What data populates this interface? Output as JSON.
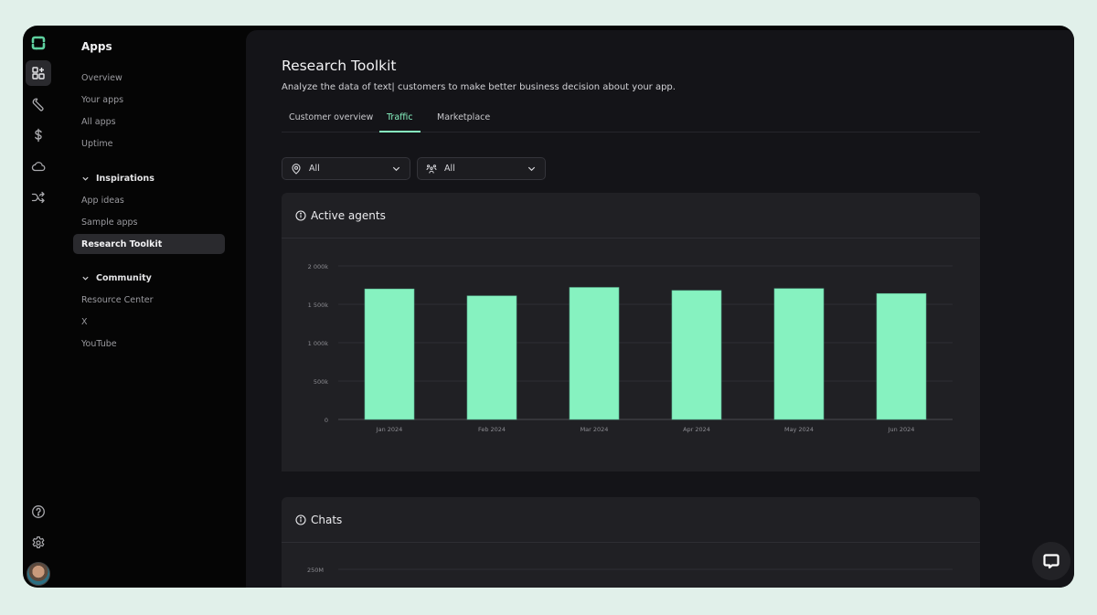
{
  "rail": {
    "items": [
      {
        "icon": "apps-grid-icon",
        "active": true
      },
      {
        "icon": "wrench-icon",
        "active": false
      },
      {
        "icon": "dollar-icon",
        "active": false
      },
      {
        "icon": "cloud-icon",
        "active": false
      },
      {
        "icon": "shuffle-icon",
        "active": false
      }
    ],
    "bottom": [
      {
        "icon": "help-icon"
      },
      {
        "icon": "gear-icon"
      }
    ]
  },
  "nav": {
    "title": "Apps",
    "items": [
      {
        "label": "Overview"
      },
      {
        "label": "Your apps"
      },
      {
        "label": "All apps"
      },
      {
        "label": "Uptime"
      }
    ],
    "sections": [
      {
        "label": "Inspirations",
        "items": [
          {
            "label": "App ideas"
          },
          {
            "label": "Sample apps"
          },
          {
            "label": "Research Toolkit",
            "active": true
          }
        ]
      },
      {
        "label": "Community",
        "items": [
          {
            "label": "Resource Center"
          },
          {
            "label": "X"
          },
          {
            "label": "YouTube"
          }
        ]
      }
    ]
  },
  "page": {
    "title": "Research Toolkit",
    "description": "Analyze the data of text| customers to make better business decision about your app.",
    "tabs": [
      {
        "label": "Customer overview",
        "active": false
      },
      {
        "label": "Traffic",
        "active": true
      },
      {
        "label": "Marketplace",
        "active": false
      }
    ],
    "filters": [
      {
        "icon": "location-pin-icon",
        "value": "All"
      },
      {
        "icon": "users-group-icon",
        "value": "All"
      }
    ]
  },
  "colors": {
    "accent": "#86f2c0",
    "bar": "#86f2c0",
    "background": "#141418",
    "card": "#202024"
  },
  "chart_data": [
    {
      "type": "bar",
      "title": "Active agents",
      "categories": [
        "Jan 2024",
        "Feb 2024",
        "Mar 2024",
        "Apr 2024",
        "May 2024",
        "Jun 2024"
      ],
      "values": [
        1700000,
        1610000,
        1720000,
        1680000,
        1705000,
        1640000
      ],
      "ylim": [
        0,
        2000000
      ],
      "yticks": [
        0,
        500000,
        1000000,
        1500000,
        2000000
      ],
      "ytick_labels": [
        "0",
        "500k",
        "1 000k",
        "1 500k",
        "2 000k"
      ],
      "xlabel": "",
      "ylabel": "",
      "grid": true,
      "legend": "none"
    },
    {
      "type": "bar",
      "title": "Chats",
      "categories": [],
      "values": [],
      "ytick_labels": [
        "250M"
      ],
      "grid": true,
      "legend": "none"
    }
  ]
}
